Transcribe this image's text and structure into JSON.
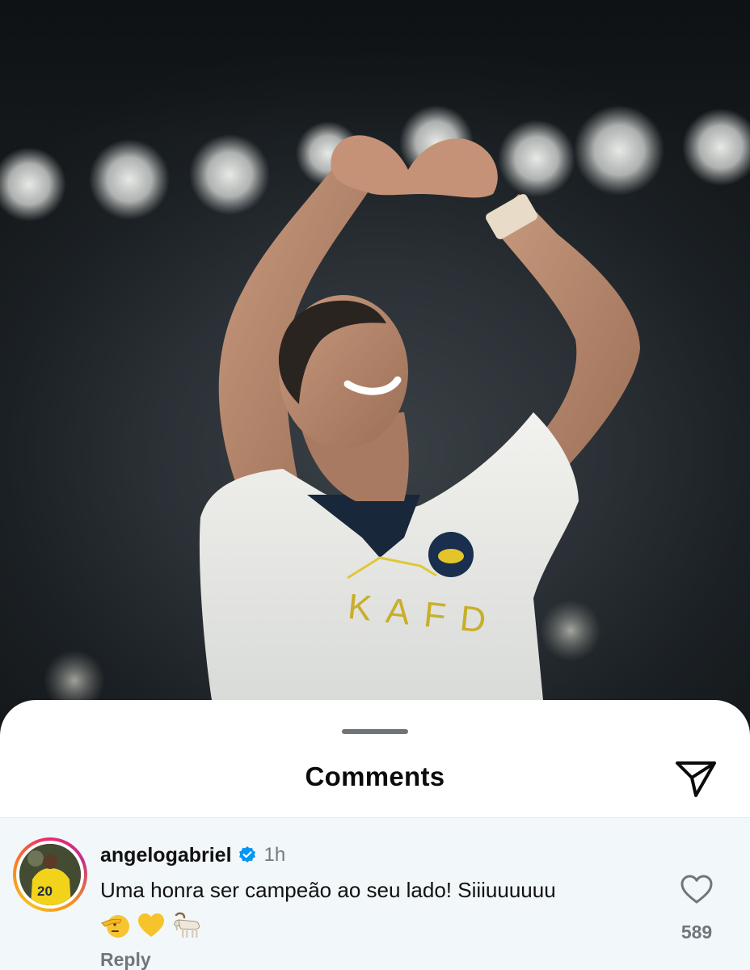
{
  "sheet": {
    "title": "Comments"
  },
  "comment": {
    "username": "angelogabriel",
    "verified": true,
    "time": "1h",
    "text": "Uma honra ser campeão ao seu lado! Siiiuuuuuu",
    "emojis": [
      "🫡",
      "💛",
      "🐐"
    ],
    "reply_label": "Reply",
    "like_count": "589",
    "avatar_jersey_number": "20"
  },
  "colors": {
    "verified_blue": "#0095f6",
    "jersey_yellow": "#f2d21a",
    "sheet_bg": "#ffffff",
    "comment_bg": "#f2f7fa"
  },
  "icons": {
    "share": "paper-plane-icon",
    "like": "heart-outline-icon",
    "verified": "verified-badge-icon"
  }
}
